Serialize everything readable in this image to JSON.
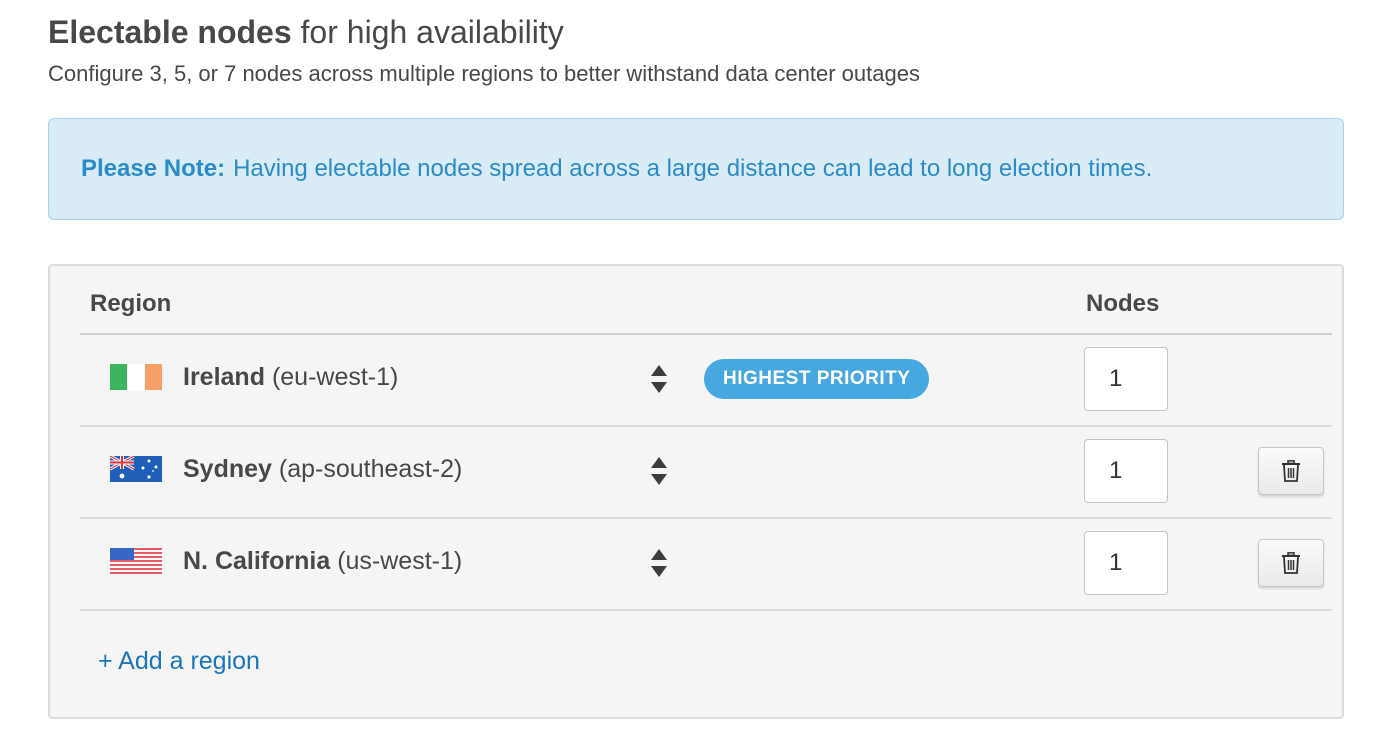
{
  "header": {
    "title_bold": "Electable nodes",
    "title_rest": "for high availability",
    "subtitle": "Configure 3, 5, or 7 nodes across multiple regions to better withstand data center outages"
  },
  "note": {
    "label": "Please Note:",
    "text": "Having electable nodes spread across a large distance can lead to long election times."
  },
  "table": {
    "col_region": "Region",
    "col_nodes": "Nodes",
    "rows": [
      {
        "name": "Ireland",
        "code": "(eu-west-1)",
        "flag": "ireland-flag-icon",
        "badge": "HIGHEST PRIORITY",
        "nodes": "1"
      },
      {
        "name": "Sydney",
        "code": "(ap-southeast-2)",
        "flag": "australia-flag-icon",
        "nodes": "1"
      },
      {
        "name": "N. California",
        "code": "(us-west-1)",
        "flag": "usa-flag-icon",
        "nodes": "1"
      }
    ],
    "add_region": "+ Add a region"
  },
  "colors": {
    "note_bg": "#d9ebf6",
    "note_text": "#2a8bc7",
    "badge_bg": "#47a7e0",
    "link": "#1b75bb"
  }
}
